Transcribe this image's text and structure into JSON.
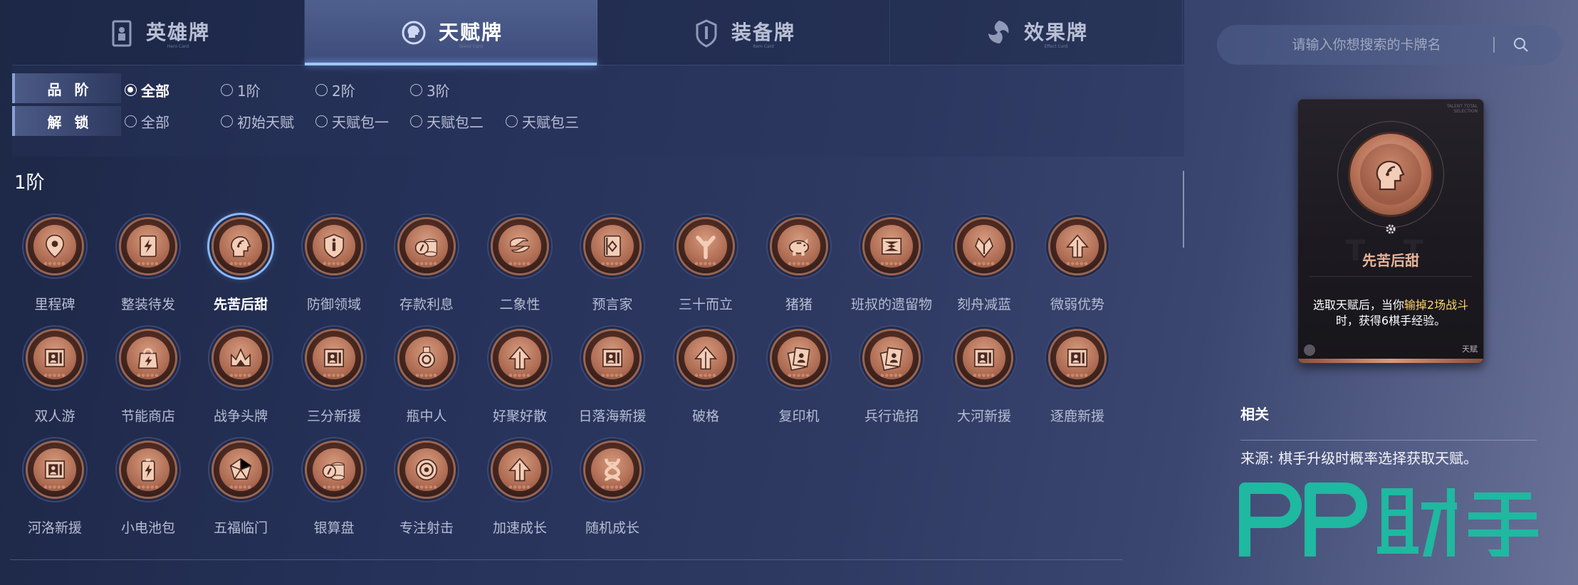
{
  "tabs": [
    {
      "label": "英雄牌",
      "sub": "Hero Card",
      "icon": "hero-card-icon",
      "active": false
    },
    {
      "label": "天赋牌",
      "sub": "Talent Card",
      "icon": "talent-card-icon",
      "active": true
    },
    {
      "label": "装备牌",
      "sub": "Item Card",
      "icon": "item-card-icon",
      "active": false
    },
    {
      "label": "效果牌",
      "sub": "Effect Card",
      "icon": "effect-card-icon",
      "active": false
    }
  ],
  "search": {
    "placeholder": "请输入你想搜索的卡牌名",
    "icon": "search-icon"
  },
  "filters": {
    "tier": {
      "label": "品阶",
      "options": [
        "全部",
        "1阶",
        "2阶",
        "3阶"
      ],
      "selected": "全部"
    },
    "unlock": {
      "label": "解锁",
      "options": [
        "全部",
        "初始天赋",
        "天赋包一",
        "天赋包二",
        "天赋包三"
      ],
      "selected": null
    }
  },
  "section_title": "1阶",
  "cards": [
    {
      "name": "里程碑",
      "icon": "map-pin-icon"
    },
    {
      "name": "整装待发",
      "icon": "card-bolt-icon"
    },
    {
      "name": "先苦后甜",
      "icon": "head-signal-icon",
      "selected": true
    },
    {
      "name": "防御领域",
      "icon": "shield-icon"
    },
    {
      "name": "存款利息",
      "icon": "coin-stack-icon"
    },
    {
      "name": "二象性",
      "icon": "swap-icon"
    },
    {
      "name": "预言家",
      "icon": "book-icon"
    },
    {
      "name": "三十而立",
      "icon": "branch-icon"
    },
    {
      "name": "猪猪",
      "icon": "piggy-bank-icon"
    },
    {
      "name": "班叔的遗留物",
      "icon": "box-arrows-icon"
    },
    {
      "name": "刻舟减蓝",
      "icon": "flower-icon"
    },
    {
      "name": "微弱优势",
      "icon": "arrow-up-icon"
    },
    {
      "name": "双人游",
      "icon": "cards-icon"
    },
    {
      "name": "节能商店",
      "icon": "shopping-bag-icon"
    },
    {
      "name": "战争头牌",
      "icon": "crown-icon"
    },
    {
      "name": "三分新援",
      "icon": "cards-icon"
    },
    {
      "name": "瓶中人",
      "icon": "bottle-icon"
    },
    {
      "name": "好聚好散",
      "icon": "arrow-up-icon"
    },
    {
      "name": "日落海新援",
      "icon": "cards-icon"
    },
    {
      "name": "破格",
      "icon": "arrow-up-icon"
    },
    {
      "name": "复印机",
      "icon": "copy-cards-icon"
    },
    {
      "name": "兵行诡招",
      "icon": "copy-cards-icon"
    },
    {
      "name": "大河新援",
      "icon": "cards-icon"
    },
    {
      "name": "逐鹿新援",
      "icon": "cards-icon"
    },
    {
      "name": "河洛新援",
      "icon": "cards-icon"
    },
    {
      "name": "小电池包",
      "icon": "battery-icon"
    },
    {
      "name": "五福临门",
      "icon": "pentagon-icon"
    },
    {
      "name": "银算盘",
      "icon": "coin-stack-icon"
    },
    {
      "name": "专注射击",
      "icon": "target-icon"
    },
    {
      "name": "加速成长",
      "icon": "arrow-up-icon"
    },
    {
      "name": "随机成长",
      "icon": "dna-icon"
    }
  ],
  "detail": {
    "tag": "TALENT TOTAL SELECTION",
    "name": "先苦后甜",
    "desc_before": "选取天赋后，当你",
    "desc_highlight": "输掉2场战斗",
    "desc_after": "时，获得6棋手经验。",
    "type": "天赋",
    "icon": "head-signal-icon"
  },
  "related": {
    "title": "相关",
    "source": "来源: 棋手升级时概率选择获取天赋。"
  },
  "watermark": "PP助手",
  "colors": {
    "accent": "#9ec6ff",
    "medal": "#b06e55",
    "highlight": "#ffd36a",
    "watermark": "#1fb8a0"
  }
}
